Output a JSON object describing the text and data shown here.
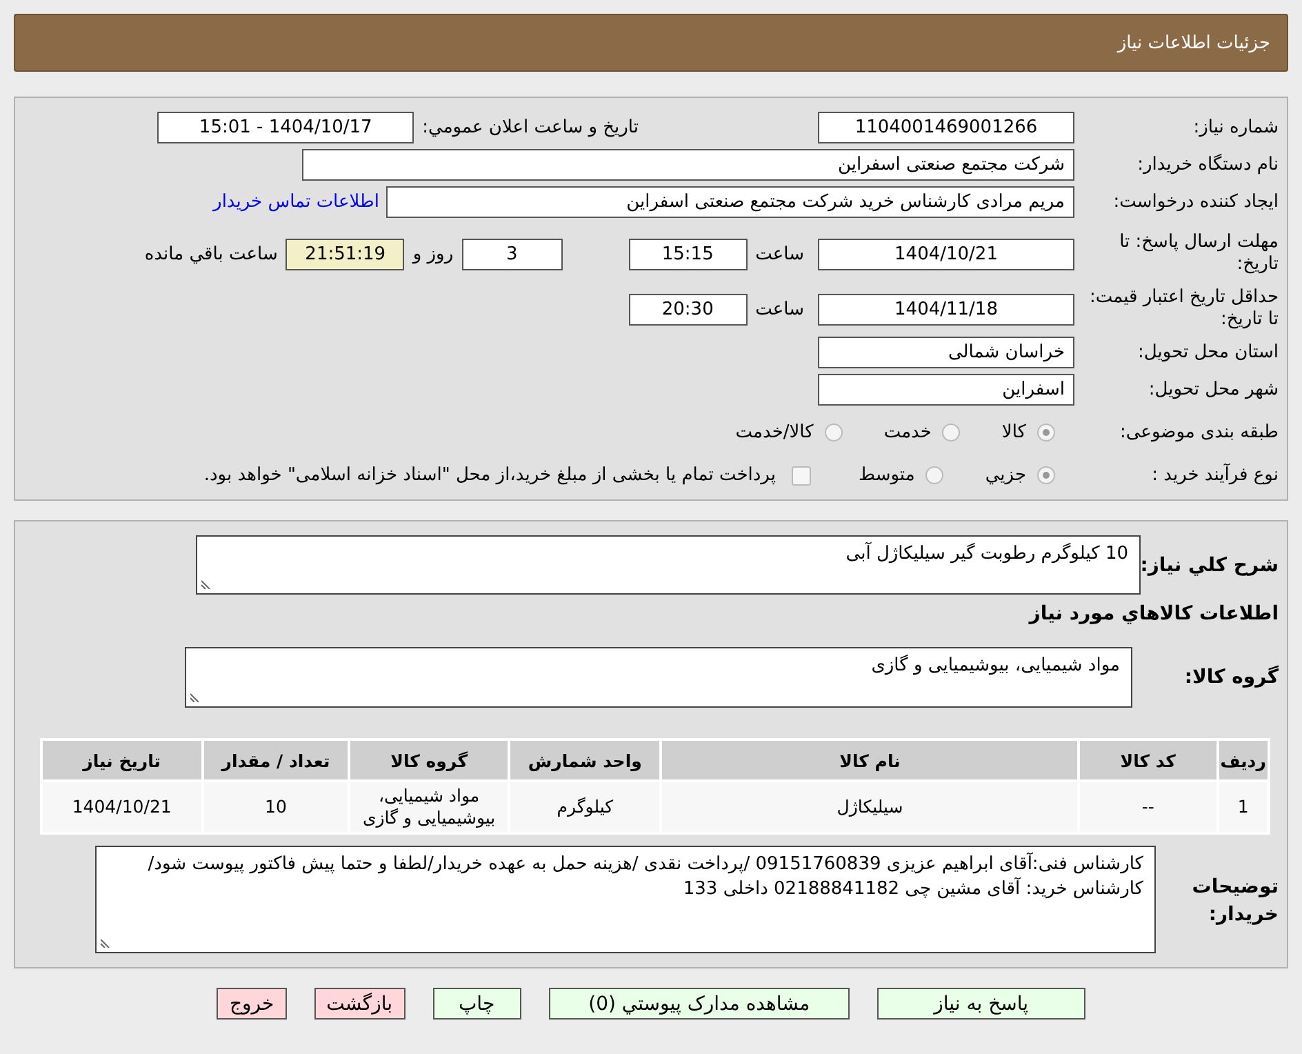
{
  "header": {
    "title": "جزئیات اطلاعات نیاز"
  },
  "details": {
    "need_number": {
      "label": "شماره نیاز:",
      "value": "1104001469001266"
    },
    "announce": {
      "label": "تاریخ و ساعت اعلان عمومي:",
      "value": "1404/10/17 - 15:01"
    },
    "buyer": {
      "label": "نام دستگاه خریدار:",
      "value": "شرکت مجتمع صنعتی اسفراین"
    },
    "requester": {
      "label": "ایجاد کننده درخواست:",
      "value": "مریم مرادی کارشناس خرید شرکت مجتمع صنعتی اسفراین",
      "link": "اطلاعات تماس خریدار"
    },
    "deadline": {
      "label": "مهلت ارسال پاسخ: تا تاریخ:",
      "date": "1404/10/21",
      "time_label": "ساعت",
      "time": "15:15",
      "days": "3",
      "days_label": "روز و",
      "remaining": "21:51:19",
      "remaining_label": "ساعت باقي مانده"
    },
    "validity": {
      "label": "حداقل تاریخ اعتبار قیمت: تا تاریخ:",
      "date": "1404/11/18",
      "time_label": "ساعت",
      "time": "20:30"
    },
    "province": {
      "label": "استان محل تحویل:",
      "value": "خراسان شمالی"
    },
    "city": {
      "label": "شهر محل تحویل:",
      "value": "اسفراین"
    },
    "category": {
      "label": "طبقه بندی موضوعی:",
      "options": [
        {
          "label": "کالا",
          "selected": true
        },
        {
          "label": "خدمت",
          "selected": false
        },
        {
          "label": "کالا/خدمت",
          "selected": false
        }
      ]
    },
    "process": {
      "label": "نوع فرآیند خرید :",
      "options": [
        {
          "label": "جزيي",
          "selected": true
        },
        {
          "label": "متوسط",
          "selected": false
        }
      ],
      "payment": {
        "label": "پرداخت تمام یا بخشی از مبلغ خرید،از محل \"اسناد خزانه اسلامی\" خواهد بود.",
        "checked": false
      }
    }
  },
  "items": {
    "description": {
      "label": "شرح کلي نیاز:",
      "value": "10 کیلوگرم رطوبت گیر سیلیکاژل آبی"
    },
    "heading": "اطلاعات کالاهاي مورد نیاز",
    "group": {
      "label": "گروه کالا:",
      "value": "مواد شیمیایی، بیوشیمیایی و  گازی"
    },
    "table": {
      "columns": [
        "ردیف",
        "کد کالا",
        "نام کالا",
        "واحد شمارش",
        "گروه کالا",
        "تعداد / مقدار",
        "تاریخ نیاز"
      ],
      "rows": [
        [
          "1",
          "--",
          "سیلیکاژل",
          "کیلوگرم",
          "مواد شیمیایی، بیوشیمیایی و گازی",
          "10",
          "1404/10/21"
        ]
      ]
    },
    "notes": {
      "label": "توضیحات خریدار:",
      "value": "کارشناس فنی:آقای ابراهیم عزیزی 09151760839 /پرداخت نقدی /هزینه حمل به عهده خریدار/لطفا و حتما پیش فاکتور پیوست شود/کارشناس خرید: آقای مشین چی 02188841182 داخلی 133"
    }
  },
  "buttons": [
    {
      "label": "پاسخ به نیاز",
      "kind": "action"
    },
    {
      "label": "مشاهده مدارک پیوستي (0)",
      "kind": "action"
    },
    {
      "label": "چاپ",
      "kind": "action"
    },
    {
      "label": "بازگشت",
      "kind": "cancel"
    },
    {
      "label": "خروج",
      "kind": "cancel"
    }
  ]
}
